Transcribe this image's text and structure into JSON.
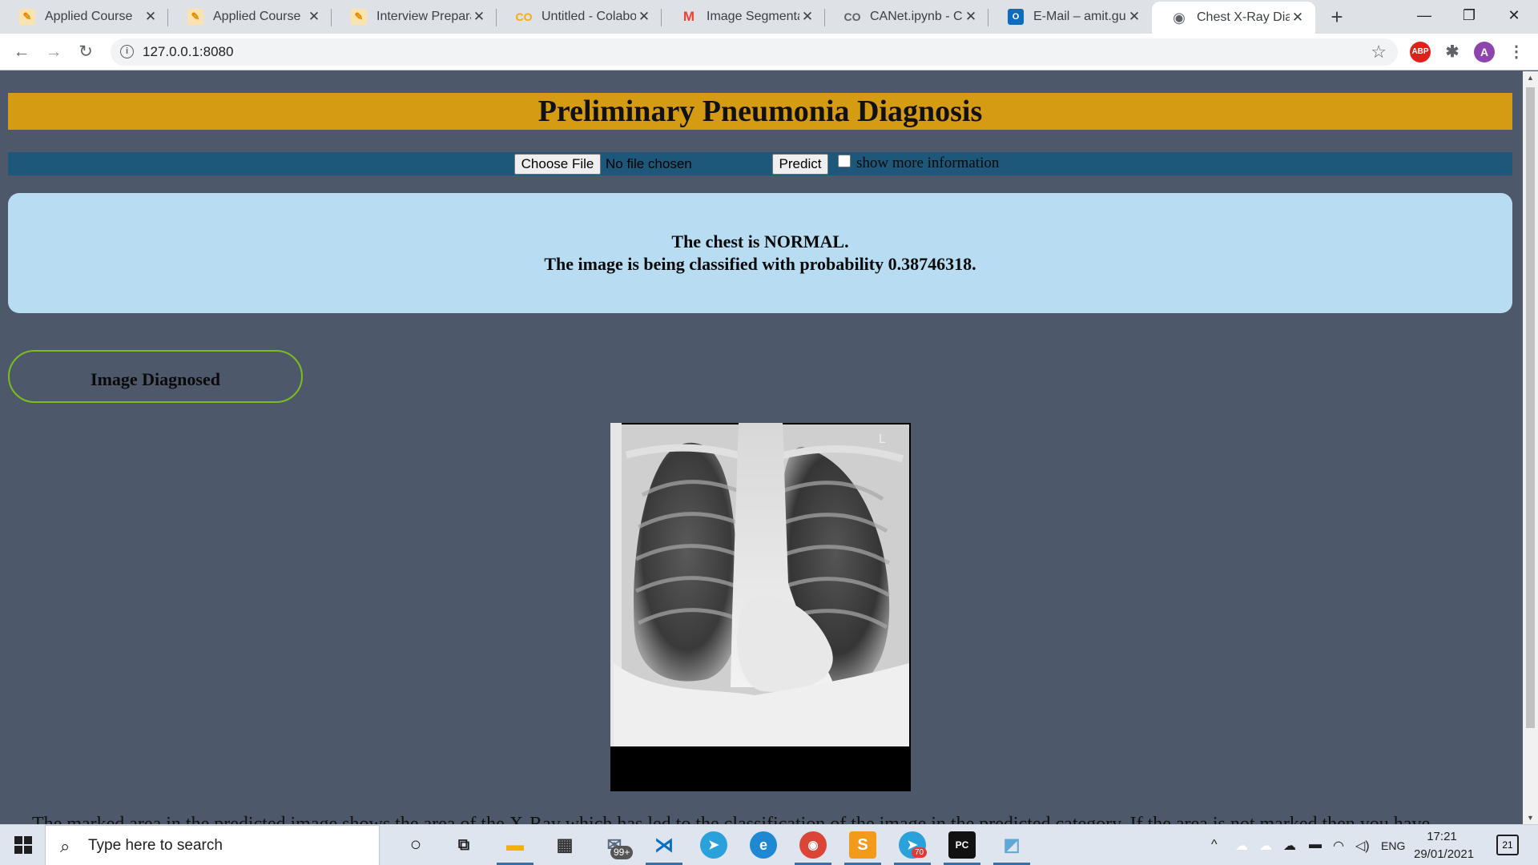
{
  "browser": {
    "tabs": [
      {
        "title": "Applied Course",
        "icon": "applied-course-icon",
        "color": "#f2a51d"
      },
      {
        "title": "Applied Course",
        "icon": "applied-course-icon",
        "color": "#f2a51d"
      },
      {
        "title": "Interview Preparati",
        "icon": "applied-course-icon",
        "color": "#f2a51d"
      },
      {
        "title": "Untitled - Colabor",
        "icon": "colab-icon",
        "color": "#f9ab00"
      },
      {
        "title": "Image Segmentati",
        "icon": "gmail-icon",
        "color": "#ea4335"
      },
      {
        "title": "CANet.ipynb - Col",
        "icon": "colab-icon",
        "color": "#5f6368"
      },
      {
        "title": "E-Mail – amit.gupt",
        "icon": "outlook-icon",
        "color": "#0f6cbd"
      },
      {
        "title": "Chest X-Ray Diagn",
        "icon": "globe-icon",
        "color": "#5f6368",
        "active": true
      }
    ],
    "url": "127.0.0.1:8080",
    "profile_initial": "A",
    "abp_label": "ABP"
  },
  "page": {
    "title": "Preliminary Pneumonia Diagnosis",
    "choose_file_label": "Choose File",
    "file_status": "No file chosen",
    "predict_label": "Predict",
    "show_more_label": "show more information",
    "result_line1": "The chest is NORMAL.",
    "result_line2": "The image is being classified with probability 0.38746318.",
    "diagnosed_label": "Image Diagnosed",
    "explanation": "The marked area in the predicted image shows the area of the X-Ray which has led to the classification of the image in the predicted category. If the area is not marked then you have",
    "colors": {
      "background": "#4d596a",
      "title_bar": "#d59b12",
      "controls_bar": "#1d577a",
      "result_box": "#b8dcf1",
      "badge_border": "#7cbd1e"
    }
  },
  "taskbar": {
    "search_placeholder": "Type here to search",
    "mail_badge": "99+",
    "telegram_badge": "70",
    "lang": "ENG",
    "time": "17:21",
    "date": "29/01/2021",
    "notifications": "21"
  }
}
